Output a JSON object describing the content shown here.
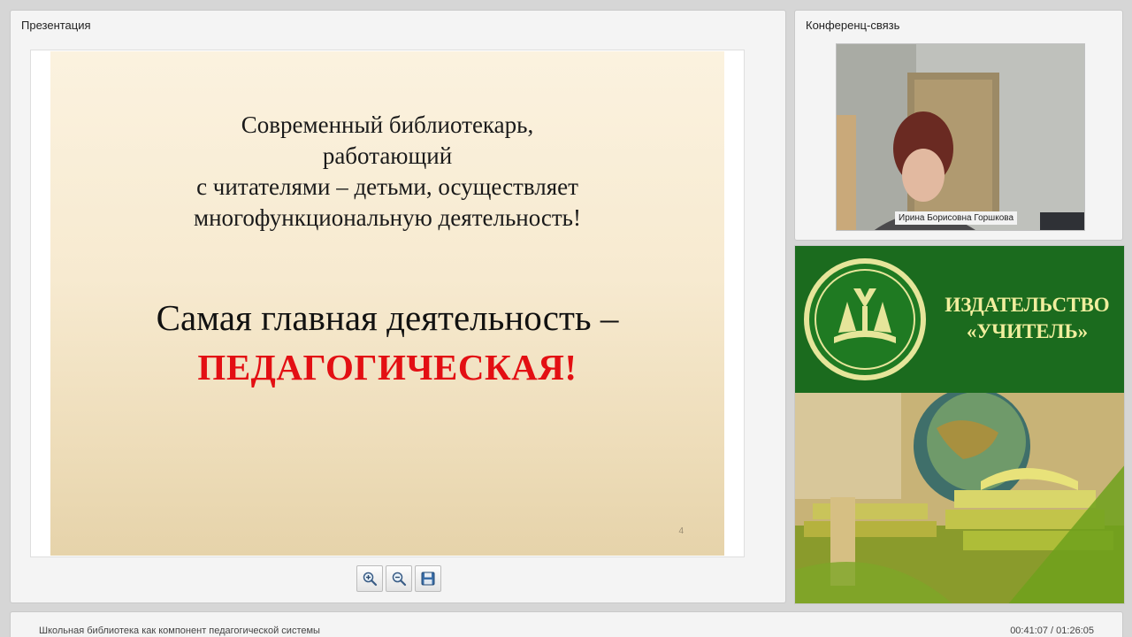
{
  "presentation": {
    "panel_title": "Презентация",
    "slide": {
      "lines": [
        "Современный библиотекарь,",
        "работающий",
        "с читателями – детьми, осуществляет",
        "многофункциональную деятельность!"
      ],
      "headline": "Самая главная деятельность –",
      "highlight": "ПЕДАГОГИЧЕСКАЯ!",
      "page_number": "4",
      "highlight_color": "#e30f13"
    },
    "toolbar": {
      "zoom_in_icon": "zoom-in-icon",
      "zoom_out_icon": "zoom-out-icon",
      "save_icon": "floppy-disk-icon"
    }
  },
  "conference": {
    "panel_title": "Конференц-связь",
    "participant_name": "Ирина Борисовна Горшкова"
  },
  "banner": {
    "publisher_line1": "ИЗДАТЕЛЬСТВО",
    "publisher_line2": "«УЧИТЕЛЬ»",
    "brand_green": "#1b6b1e",
    "brand_text_color": "#f1ee9e"
  },
  "footer": {
    "webinar_title": "Школьная библиотека как компонент педагогической системы",
    "time": "00:41:07 / 01:26:05"
  }
}
